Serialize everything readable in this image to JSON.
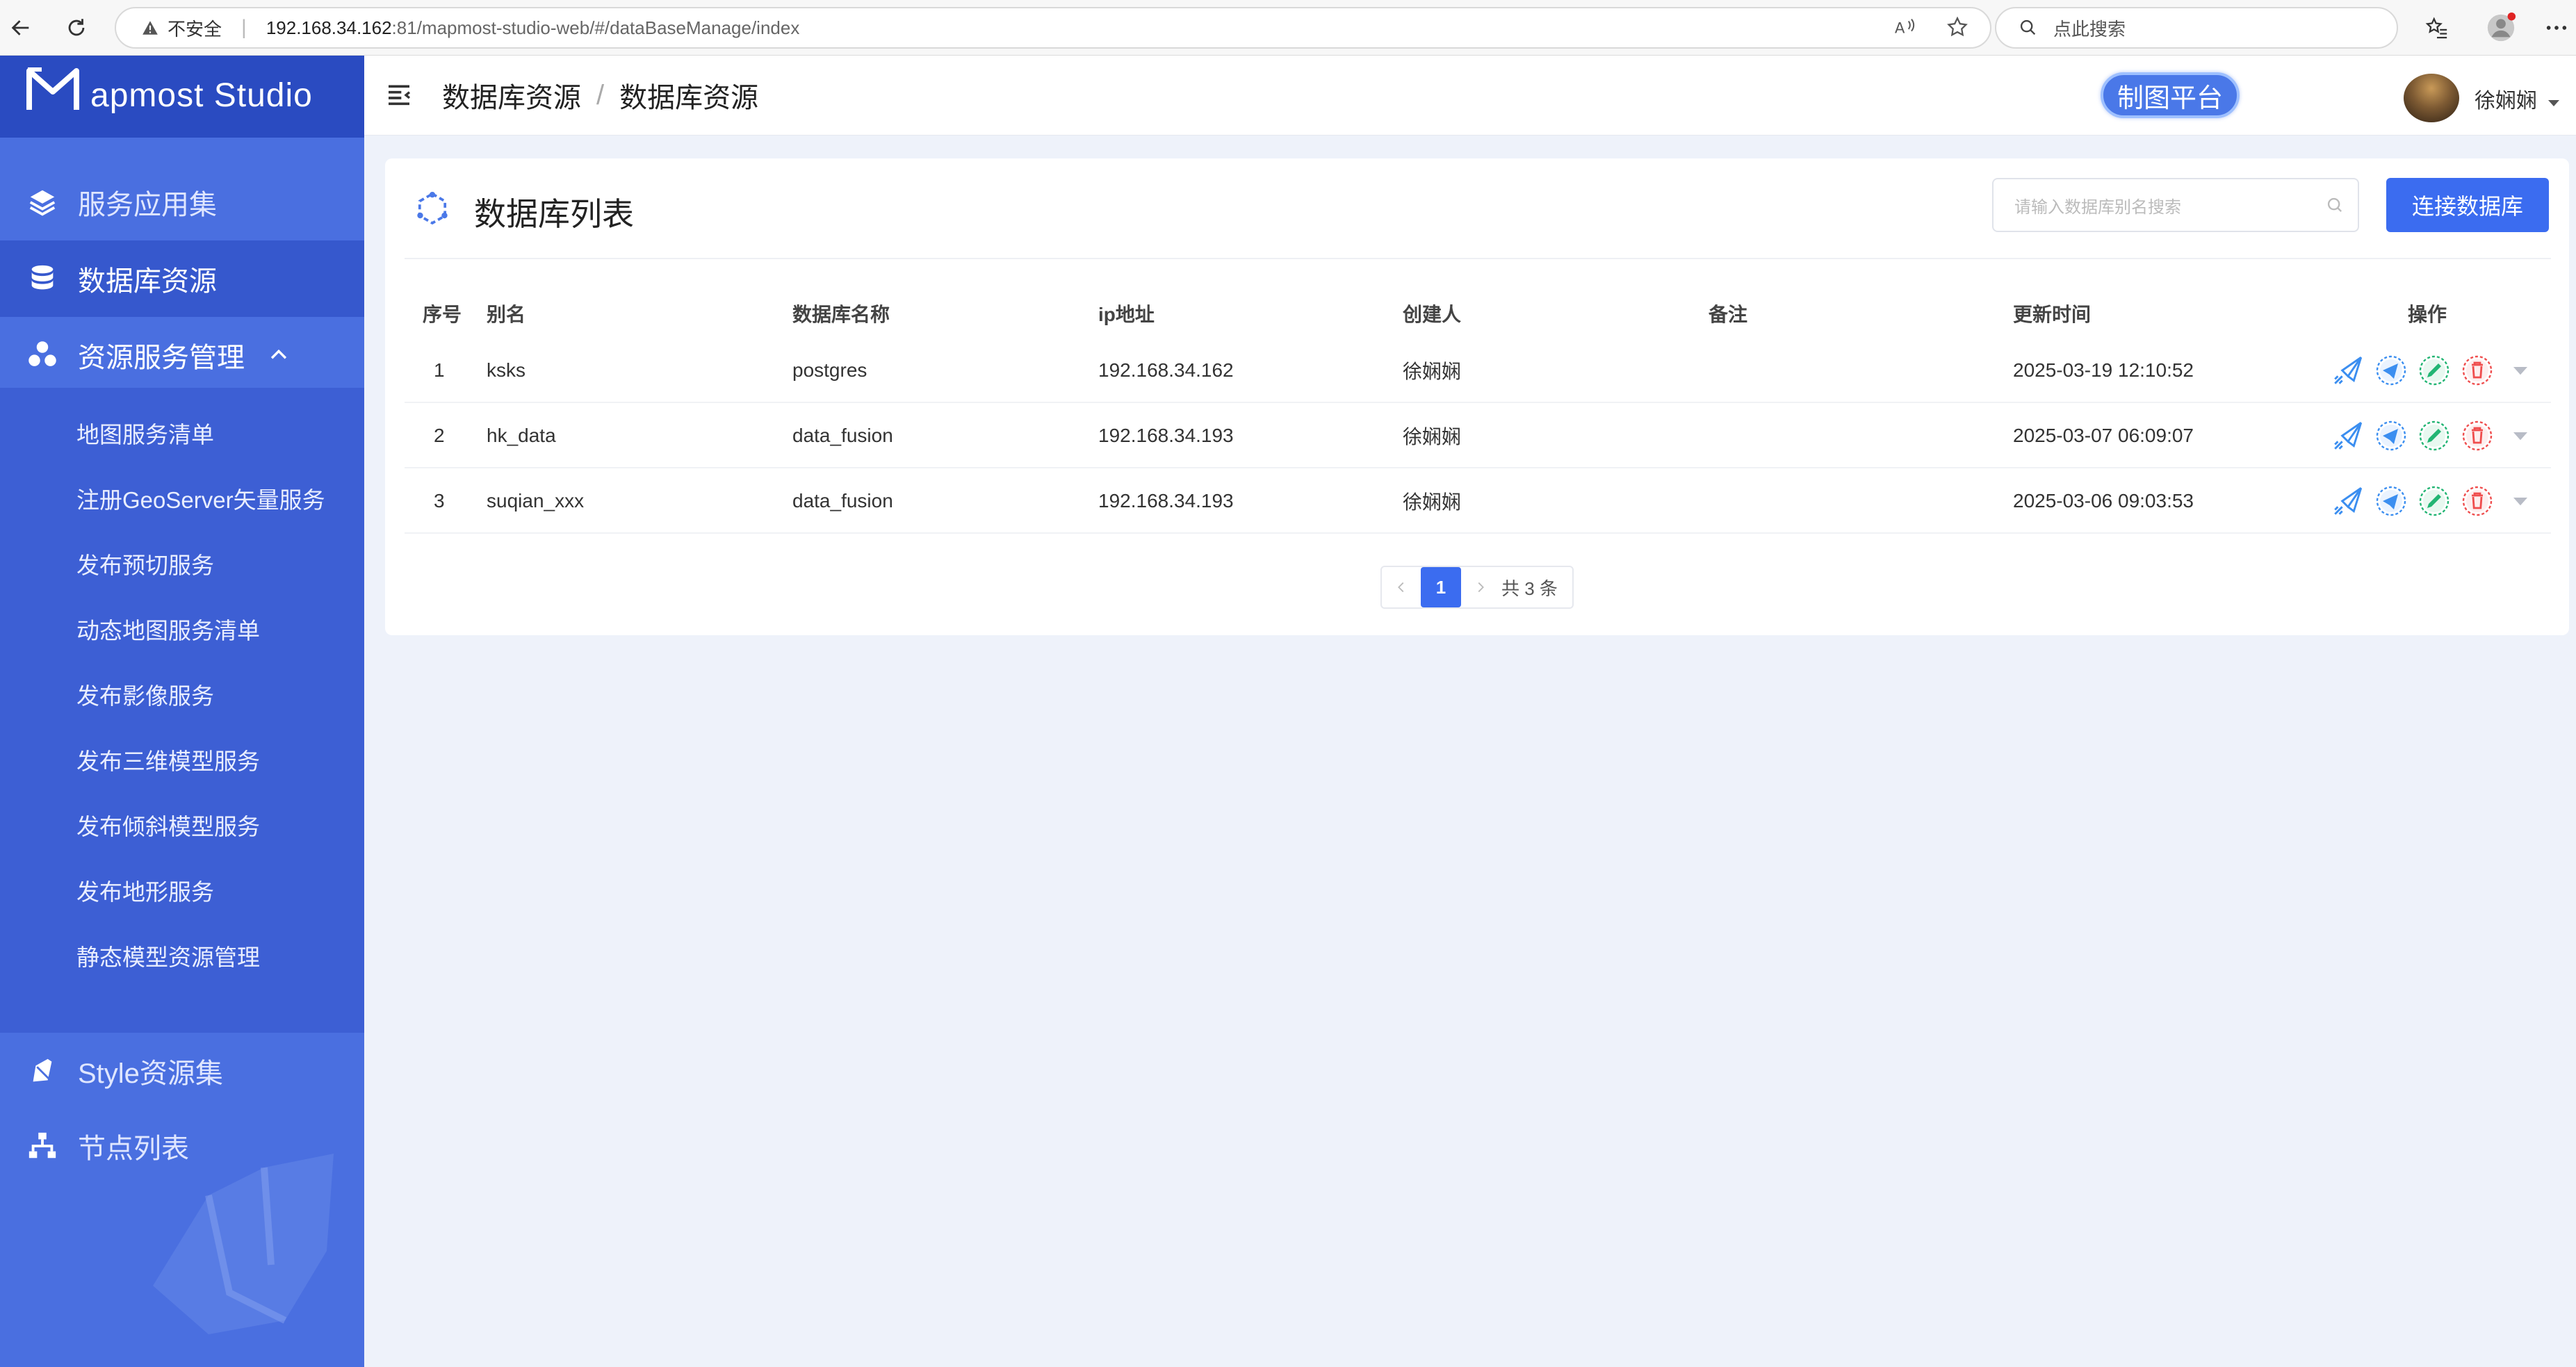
{
  "browser": {
    "insecure_label": "不安全",
    "url_host": "192.168.34.162",
    "url_rest": ":81/mapmost-studio-web/#/dataBaseManage/index",
    "search_placeholder": "点此搜索"
  },
  "sidebar": {
    "logo_text": "apmost Studio",
    "items": [
      {
        "label": "服务应用集",
        "icon": "layers-icon"
      },
      {
        "label": "数据库资源",
        "icon": "database-icon"
      },
      {
        "label": "资源服务管理",
        "icon": "cluster-icon"
      },
      {
        "label": "Style资源集",
        "icon": "style-icon"
      },
      {
        "label": "节点列表",
        "icon": "node-tree-icon"
      }
    ],
    "sub_items": [
      "地图服务清单",
      "注册GeoServer矢量服务",
      "发布预切服务",
      "动态地图服务清单",
      "发布影像服务",
      "发布三维模型服务",
      "发布倾斜模型服务",
      "发布地形服务",
      "静态模型资源管理"
    ]
  },
  "header": {
    "breadcrumb": [
      "数据库资源",
      "数据库资源"
    ],
    "platform_button": "制图平台",
    "user_name": "徐娴娴"
  },
  "card": {
    "title": "数据库列表",
    "search_placeholder": "请输入数据库别名搜索",
    "connect_button": "连接数据库"
  },
  "table": {
    "columns": [
      "序号",
      "别名",
      "数据库名称",
      "ip地址",
      "创建人",
      "备注",
      "更新时间",
      "操作"
    ],
    "rows": [
      {
        "index": "1",
        "alias": "ksks",
        "db_name": "postgres",
        "ip": "192.168.34.162",
        "creator": "徐娴娴",
        "note": "",
        "updated": "2025-03-19 12:10:52"
      },
      {
        "index": "2",
        "alias": "hk_data",
        "db_name": "data_fusion",
        "ip": "192.168.34.193",
        "creator": "徐娴娴",
        "note": "",
        "updated": "2025-03-07 06:09:07"
      },
      {
        "index": "3",
        "alias": "suqian_xxx",
        "db_name": "data_fusion",
        "ip": "192.168.34.193",
        "creator": "徐娴娴",
        "note": "",
        "updated": "2025-03-06 09:03:53"
      }
    ]
  },
  "pagination": {
    "current": "1",
    "total": "共 3 条"
  },
  "colors": {
    "sidebar": "#4a6fe0",
    "sidebar_dark": "#2a4bc1",
    "primary": "#3b6cf0",
    "bg": "#eef2fa"
  }
}
